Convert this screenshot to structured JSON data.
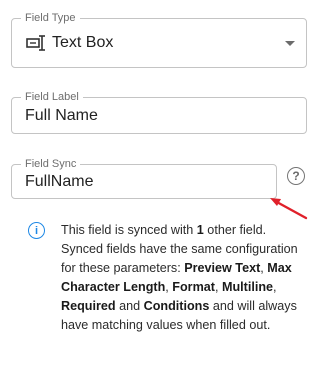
{
  "field_type": {
    "legend": "Field Type",
    "value": "Text Box",
    "icon": "text-box-icon"
  },
  "field_label": {
    "legend": "Field Label",
    "value": "Full Name"
  },
  "field_sync": {
    "legend": "Field Sync",
    "value": "FullName",
    "help_glyph": "?"
  },
  "info": {
    "icon_glyph": "i",
    "t1": "This field is synced with ",
    "b1": "1",
    "t2": " other field. Synced fields have the same configuration for these parameters: ",
    "b2": "Preview Text",
    "t3": ", ",
    "b3": "Max Character Length",
    "t4": ", ",
    "b4": "Format",
    "t5": ", ",
    "b5": "Multiline",
    "t6": ", ",
    "b6": "Required",
    "t7": " and ",
    "b7": "Conditions",
    "t8": " and will always have matching values when filled out."
  },
  "colors": {
    "accent": "#1e88e5",
    "annotation": "#e0202a",
    "border": "#c4c4c4"
  }
}
